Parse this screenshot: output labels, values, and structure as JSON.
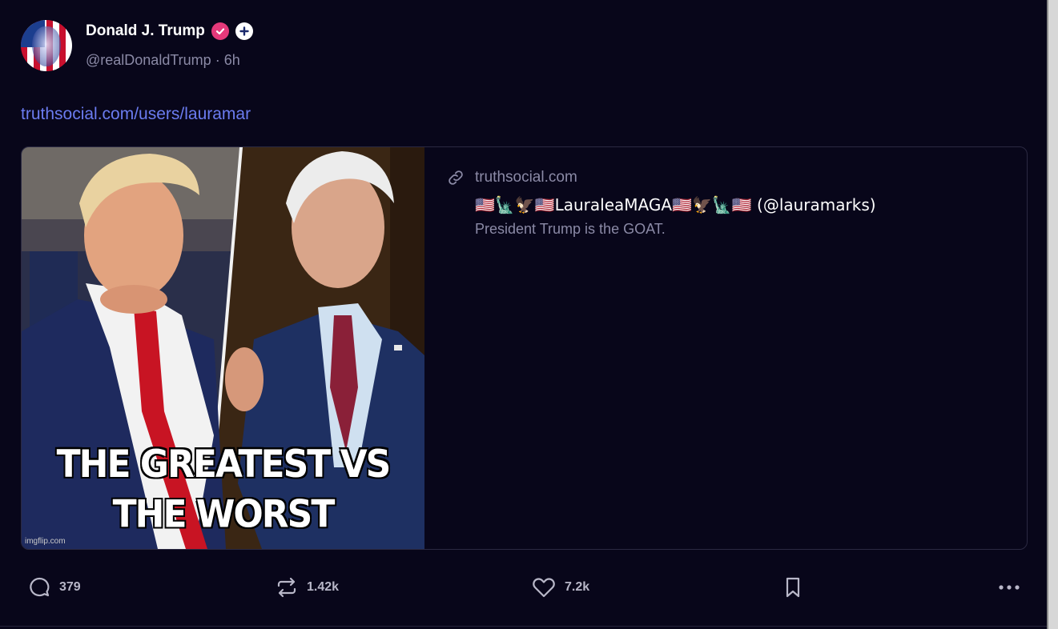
{
  "author": {
    "display_name": "Donald J. Trump",
    "handle": "@realDonaldTrump",
    "separator": "·",
    "time": "6h",
    "verified_icon": "verified-badge-icon",
    "plus_icon": "plus-badge-icon"
  },
  "post": {
    "link_text": "truthsocial.com/users/lauramar"
  },
  "link_card": {
    "image_caption_line1": "THE GREATEST VS",
    "image_caption_line2": "THE WORST",
    "image_watermark": "imgflip.com",
    "domain": "truthsocial.com",
    "title": "🇺🇸🗽🦅🇺🇸LauraleaMAGA🇺🇸🦅🗽🇺🇸 (@lauramarks)",
    "description": "President Trump is the GOAT."
  },
  "actions": {
    "reply_count": "379",
    "retruth_count": "1.42k",
    "like_count": "7.2k"
  },
  "colors": {
    "background": "#08061a",
    "link": "#6b7cf0",
    "muted": "#8b8aa6",
    "verified": "#e5397a"
  }
}
